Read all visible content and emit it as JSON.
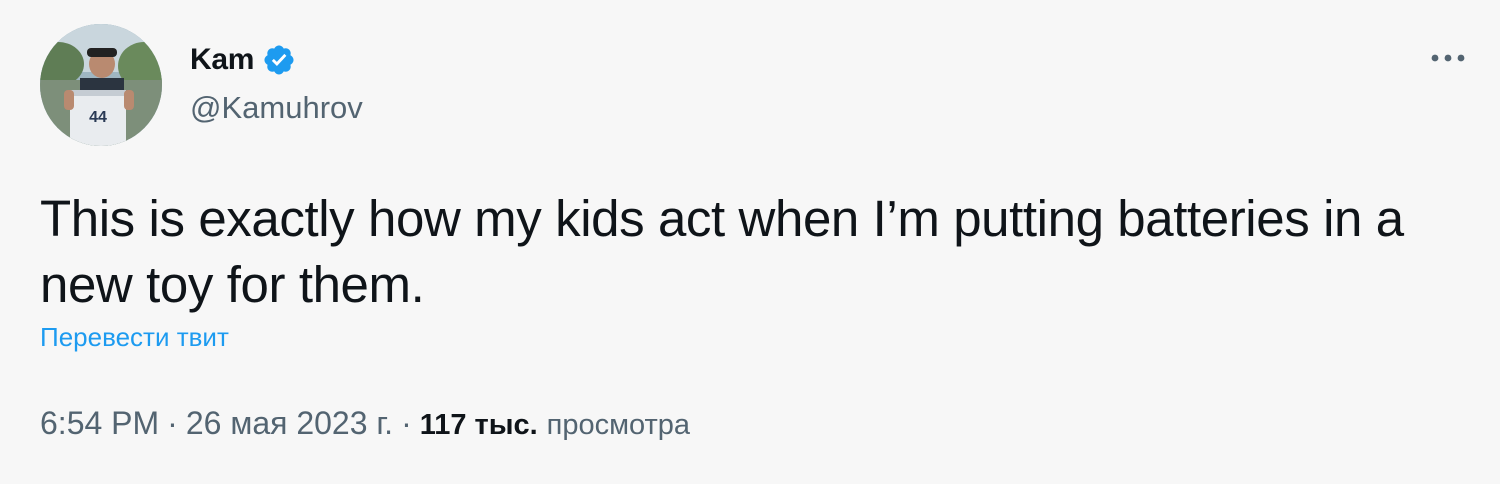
{
  "author": {
    "display_name": "Kam",
    "handle": "@Kamuhrov",
    "verified": true,
    "avatar_jersey_number": "44"
  },
  "tweet": {
    "text": "This is exactly how my kids act when I’m putting batteries in a new toy for them.",
    "translate_label": "Перевести твит"
  },
  "meta": {
    "time": "6:54 PM",
    "separator": "·",
    "date": "26 мая 2023 г.",
    "views_count": "117 тыс.",
    "views_label": "просмотра"
  },
  "icons": {
    "verified": "verified-badge-icon",
    "more": "more-dots-icon"
  },
  "colors": {
    "background": "#f7f7f7",
    "text": "#0f1419",
    "secondary": "#536471",
    "accent": "#1d9bf0"
  }
}
